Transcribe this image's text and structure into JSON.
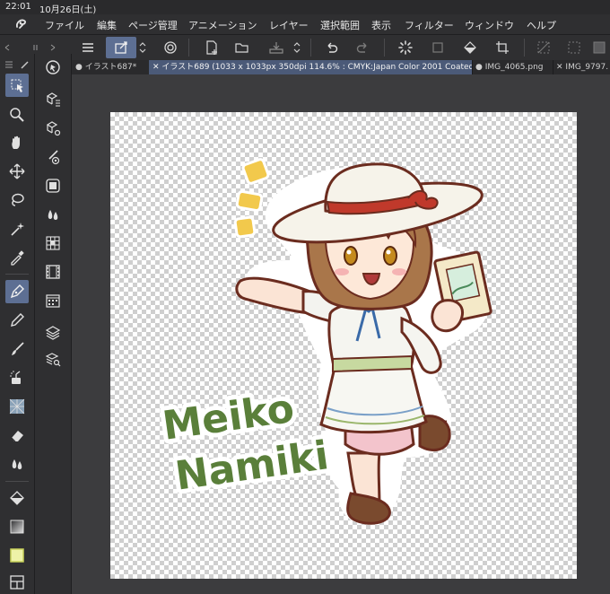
{
  "status": {
    "time": "22:01",
    "date": "10月26日(土)"
  },
  "menu": {
    "items": [
      "ファイル",
      "編集",
      "ページ管理",
      "アニメーション",
      "レイヤー",
      "選択範囲",
      "表示",
      "フィルター",
      "ウィンドウ",
      "ヘルプ"
    ]
  },
  "tabs": [
    {
      "label": "イラスト687*",
      "prefix": "●"
    },
    {
      "label": "イラスト689 (1033 x 1033px 350dpi 114.6% : CMYK:Japan Color 2001 Coated)",
      "prefix": "✕"
    },
    {
      "label": "IMG_4065.png",
      "prefix": "●"
    },
    {
      "label": "IMG_9797.",
      "prefix": "✕"
    }
  ],
  "artwork": {
    "line1": "Meiko",
    "line2": "Namiki"
  },
  "colors": {
    "accent": "#5d6f93",
    "name_green": "#5a7f3a",
    "outline_brown": "#6b2c1f",
    "hair": "#a9764a",
    "ribbon": "#c0392b",
    "sparkle": "#f2c94c"
  },
  "icons": {
    "app": "clip-studio-logo-icon"
  }
}
